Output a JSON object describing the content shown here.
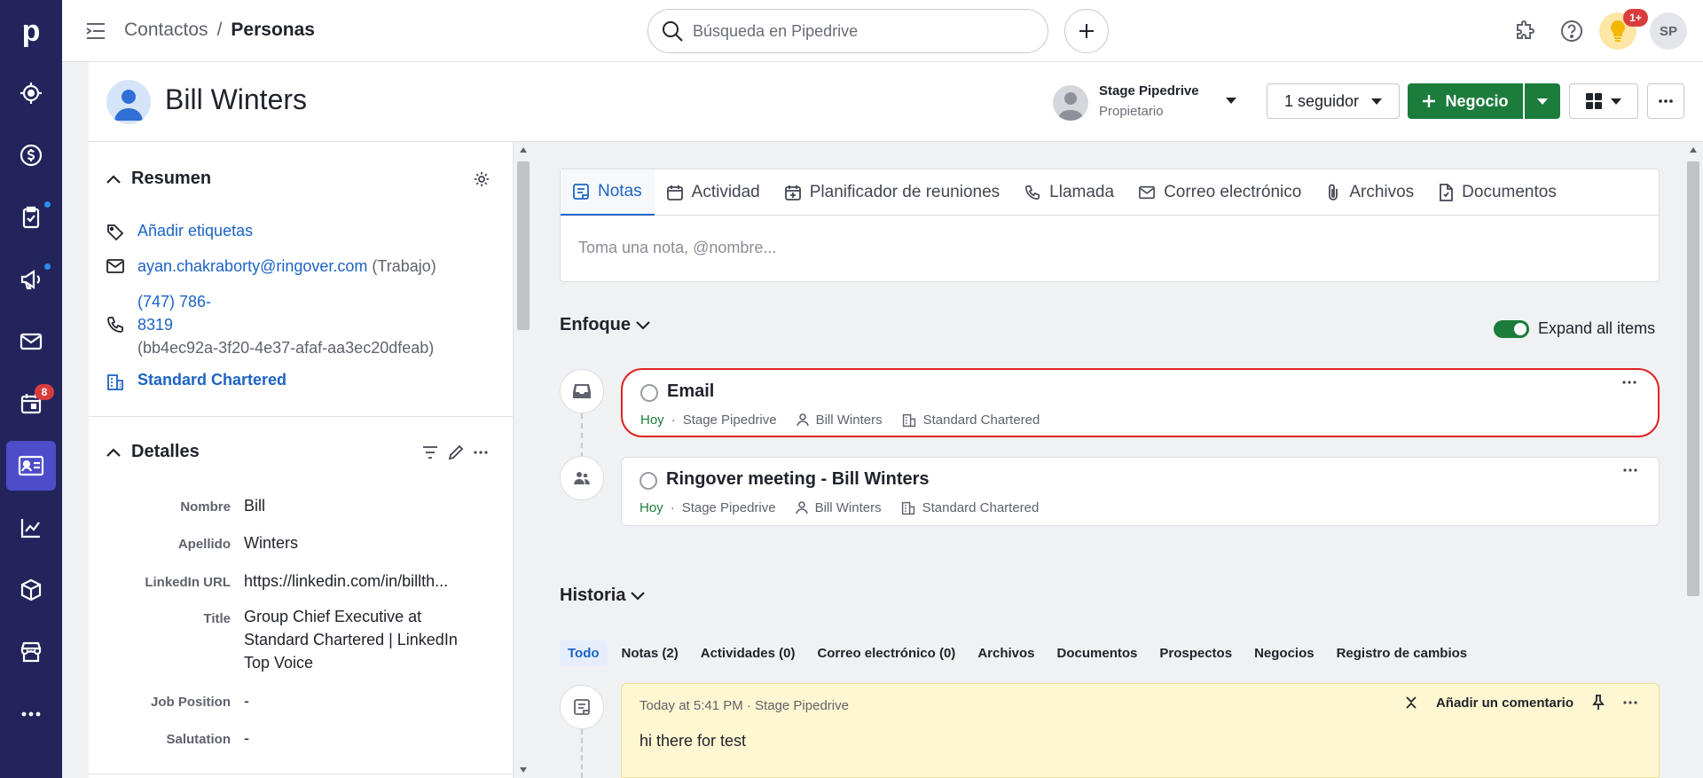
{
  "nav": {
    "logo": "p",
    "calendar_badge": "8"
  },
  "topbar": {
    "breadcrumb_parent": "Contactos",
    "breadcrumb_sep": "/",
    "breadcrumb_current": "Personas",
    "search_placeholder": "Búsqueda en Pipedrive",
    "notif_badge": "1+",
    "user_initials": "SP"
  },
  "header": {
    "person_name": "Bill Winters",
    "owner_name": "Stage Pipedrive",
    "owner_role": "Propietario",
    "follow_label": "1 seguidor",
    "deal_label": "Negocio"
  },
  "summary": {
    "title": "Resumen",
    "add_tags": "Añadir etiquetas",
    "email": "ayan.chakraborty@ringover.com",
    "email_type": "(Trabajo)",
    "phone_line1": "(747) 786-",
    "phone_line2": "8319",
    "phone_id": "(bb4ec92a-3f20-4e37-afaf-aa3ec20dfeab)",
    "organization": "Standard Chartered"
  },
  "details": {
    "title": "Detalles",
    "fields": [
      {
        "label": "Nombre",
        "value": "Bill"
      },
      {
        "label": "Apellido",
        "value": "Winters"
      },
      {
        "label": "LinkedIn URL",
        "value": "https://linkedin.com/in/billth..."
      },
      {
        "label": "Title",
        "value": "Group Chief Executive at Standard Chartered | LinkedIn Top Voice"
      },
      {
        "label": "Job Position",
        "value": "-"
      },
      {
        "label": "Salutation",
        "value": "-"
      }
    ]
  },
  "composer": {
    "tabs": [
      "Notas",
      "Actividad",
      "Planificador de reuniones",
      "Llamada",
      "Correo electrónico",
      "Archivos",
      "Documentos"
    ],
    "placeholder": "Toma una nota, @nombre..."
  },
  "focus": {
    "title": "Enfoque",
    "expand_label": "Expand all items",
    "items": [
      {
        "title": "Email",
        "when": "Hoy",
        "owner": "Stage Pipedrive",
        "person": "Bill Winters",
        "org": "Standard Chartered"
      },
      {
        "title": "Ringover meeting - Bill Winters",
        "when": "Hoy",
        "owner": "Stage Pipedrive",
        "person": "Bill Winters",
        "org": "Standard Chartered"
      }
    ]
  },
  "history": {
    "title": "Historia",
    "tabs": [
      "Todo",
      "Notas (2)",
      "Actividades (0)",
      "Correo electrónico (0)",
      "Archivos",
      "Documentos",
      "Prospectos",
      "Negocios",
      "Registro de cambios"
    ],
    "note": {
      "meta": "Today at 5:41 PM · Stage Pipedrive",
      "comment_label": "Añadir un comentario",
      "body": "hi there for test"
    }
  },
  "colors": {
    "rail": "#23245c",
    "accent": "#1c63c4",
    "primary_green": "#1b7c3c",
    "highlight_red": "#e02424",
    "note_bg": "#fff7d1"
  }
}
